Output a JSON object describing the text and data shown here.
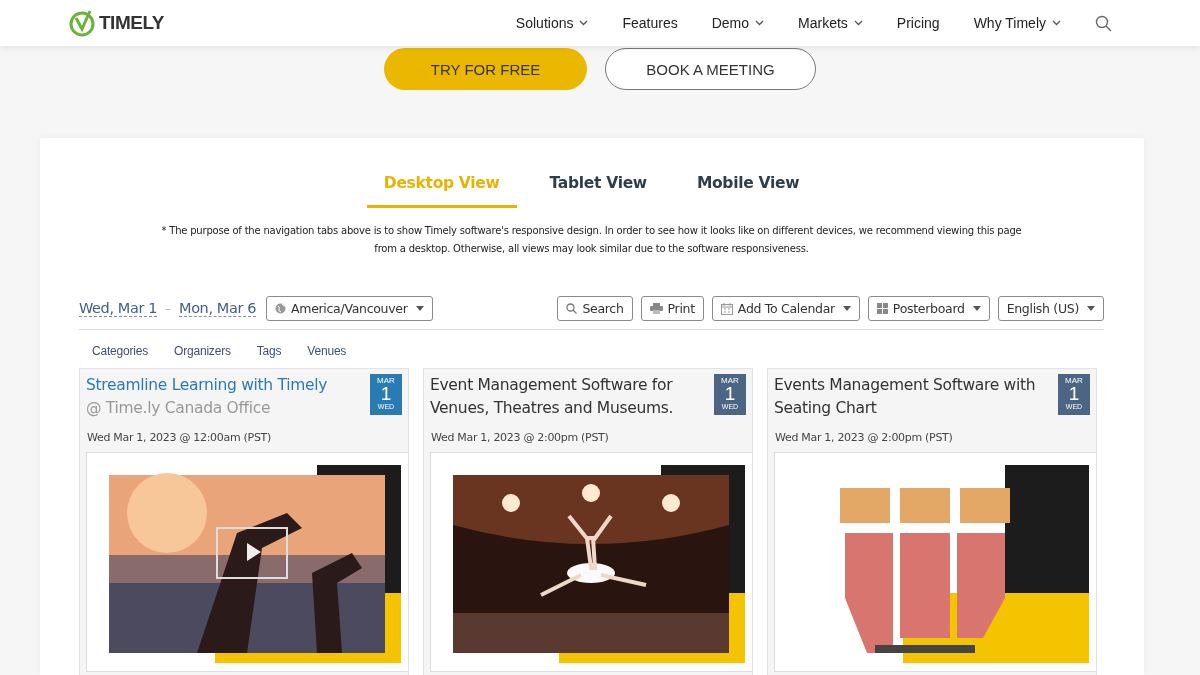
{
  "header": {
    "logo": "TIMELY",
    "nav": [
      {
        "label": "Solutions",
        "dropdown": true
      },
      {
        "label": "Features",
        "dropdown": false
      },
      {
        "label": "Demo",
        "dropdown": true
      },
      {
        "label": "Markets",
        "dropdown": true
      },
      {
        "label": "Pricing",
        "dropdown": false
      },
      {
        "label": "Why Timely",
        "dropdown": true
      }
    ]
  },
  "cta": [
    {
      "label": "TRY FOR FREE",
      "kind": "primary"
    },
    {
      "label": "BOOK A MEETING",
      "kind": "outline"
    }
  ],
  "view_tabs": [
    {
      "label": "Desktop View",
      "selected": true
    },
    {
      "label": "Tablet View",
      "selected": false
    },
    {
      "label": "Mobile View",
      "selected": false
    }
  ],
  "note": "* The purpose of the navigation tabs above is to show Timely software's responsive design. In order to see how it looks like on different devices, we recommend viewing this page from a desktop. Otherwise, all views may look similar due to the software responsiveness.",
  "toolbar": {
    "date_from": "Wed, Mar 1",
    "separator": "–",
    "date_to": "Mon, Mar 6",
    "timezone": "America/Vancouver",
    "buttons": [
      {
        "label": "Search",
        "dropdown": false
      },
      {
        "label": "Print",
        "dropdown": false
      },
      {
        "label": "Add To Calendar",
        "dropdown": true
      },
      {
        "label": "Posterboard",
        "dropdown": true
      },
      {
        "label": "English (US)",
        "dropdown": true
      }
    ]
  },
  "filters": [
    "Categories",
    "Organizers",
    "Tags",
    "Venues"
  ],
  "events": [
    {
      "title": "Streamline Learning with Timely",
      "venue": "@ Time.ly Canada Office",
      "month": "MAR",
      "day": "1",
      "weekday": "WED",
      "datetime": "Wed Mar 1, 2023 @ 12:00am (PST)",
      "selected": true,
      "color": "#2b7bb3"
    },
    {
      "title": "Event Management Software for Venues, Theatres and Museums.",
      "month": "MAR",
      "day": "1",
      "weekday": "WED",
      "datetime": "Wed Mar 1, 2023 @ 2:00pm (PST)",
      "selected": false,
      "color": "#4d6584"
    },
    {
      "title": "Events Management Software with Seating Chart",
      "month": "MAR",
      "day": "1",
      "weekday": "WED",
      "datetime": "Wed Mar 1, 2023 @ 2:00pm (PST)",
      "selected": false,
      "color": "#4d6584"
    }
  ]
}
